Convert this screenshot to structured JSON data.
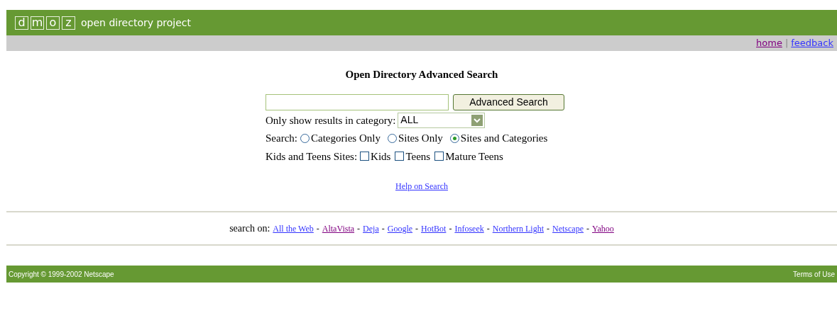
{
  "header": {
    "logo_letters": [
      "d",
      "m",
      "o",
      "z"
    ],
    "tagline": "open directory project"
  },
  "top_links": [
    {
      "label": "home",
      "visited": true
    },
    {
      "label": "feedback",
      "visited": false
    }
  ],
  "top_links_separator": "|",
  "title": "Open Directory Advanced Search",
  "search_button": "Advanced Search",
  "category": {
    "label": "Only show results in category:",
    "value": "ALL"
  },
  "search_scope": {
    "label": "Search:",
    "options": [
      {
        "label": "Categories Only",
        "selected": false
      },
      {
        "label": "Sites Only",
        "selected": false
      },
      {
        "label": "Sites and Categories",
        "selected": true
      }
    ]
  },
  "kids_teens": {
    "label": "Kids and Teens Sites:",
    "options": [
      {
        "label": "Kids",
        "checked": false
      },
      {
        "label": "Teens",
        "checked": false
      },
      {
        "label": "Mature Teens",
        "checked": false
      }
    ]
  },
  "help_link": "Help on Search",
  "search_on": {
    "label": "search on:",
    "separator": "-",
    "engines": [
      {
        "label": "All the Web",
        "visited": false
      },
      {
        "label": "AltaVista",
        "visited": true
      },
      {
        "label": "Deja",
        "visited": false
      },
      {
        "label": "Google",
        "visited": false
      },
      {
        "label": "HotBot",
        "visited": false
      },
      {
        "label": "Infoseek",
        "visited": false
      },
      {
        "label": "Northern Light",
        "visited": false
      },
      {
        "label": "Netscape",
        "visited": false
      },
      {
        "label": "Yahoo",
        "visited": true
      }
    ]
  },
  "footer": {
    "copyright": "Copyright © 1999-2002 Netscape",
    "terms": "Terms of Use"
  }
}
